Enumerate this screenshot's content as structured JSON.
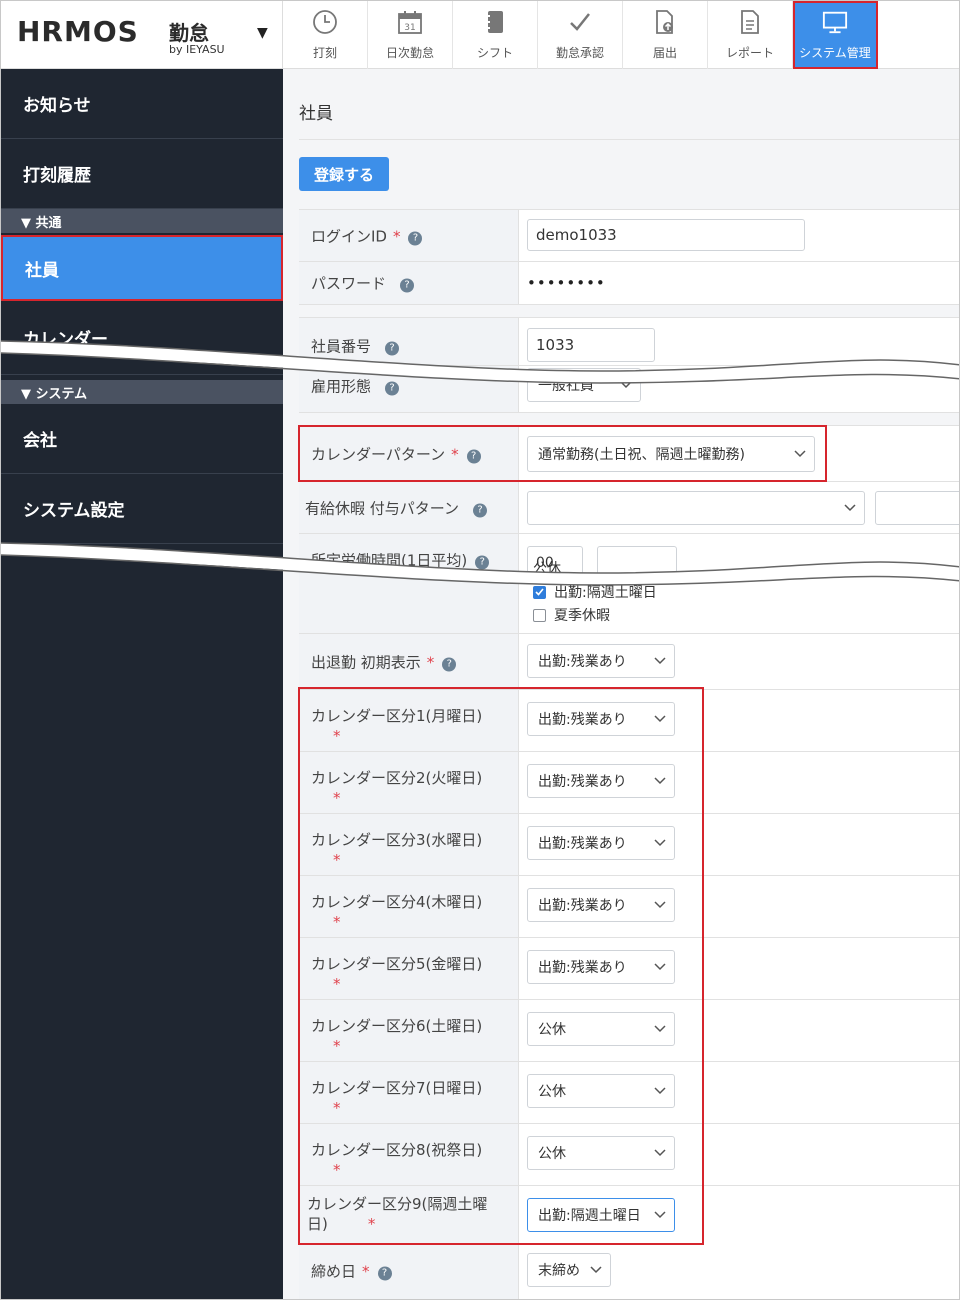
{
  "app": {
    "logo_text": "HRMOS",
    "logo_kintai": "勤怠",
    "logo_by": "by IEYASU"
  },
  "topnav": [
    {
      "label": "打刻",
      "icon": "clock-icon"
    },
    {
      "label": "日次勤怠",
      "icon": "calendar-icon"
    },
    {
      "label": "シフト",
      "icon": "notebook-icon"
    },
    {
      "label": "勤怠承認",
      "icon": "checkmark-icon"
    },
    {
      "label": "届出",
      "icon": "document-upload-icon"
    },
    {
      "label": "レポート",
      "icon": "report-icon"
    },
    {
      "label": "システム管理",
      "icon": "monitor-icon",
      "active": true
    }
  ],
  "sidebar": {
    "items_top": [
      {
        "label": "お知らせ"
      },
      {
        "label": "打刻履歴"
      }
    ],
    "section_common": "▼ 共通",
    "item_employee": "社員",
    "item_calendar_partial": "カレンダー",
    "section_system": "▼ システム",
    "item_company": "会社",
    "item_system_settings": "システム設定"
  },
  "main": {
    "page_title": "社員",
    "register_button": "登録する",
    "rows": {
      "login_id": {
        "label": "ログインID",
        "value": "demo1033",
        "required": true
      },
      "password": {
        "label": "パスワード",
        "value": "••••••••"
      },
      "employee_no": {
        "label": "社員番号",
        "value": "1033"
      },
      "employment_type": {
        "label": "雇用形態",
        "value": "一般社員"
      },
      "calendar_pattern": {
        "label": "カレンダーパターン",
        "value": "通常勤務(土日祝、隔週土曜勤務)",
        "required": true
      },
      "paid_leave": {
        "label": "有給休暇 付与パターン",
        "value": ""
      },
      "work_hours": {
        "label": "所定労働時間(1日平均)",
        "value": "00"
      },
      "checks": [
        {
          "label": "公休",
          "checked": false
        },
        {
          "label": "出勤:隔週土曜日",
          "checked": true
        },
        {
          "label": "夏季休暇",
          "checked": false
        }
      ],
      "initial_display": {
        "label": "出退勤 初期表示",
        "value": "出勤:残業あり",
        "required": true
      },
      "calendar_divisions": [
        {
          "label": "カレンダー区分1(月曜日)",
          "value": "出勤:残業あり"
        },
        {
          "label": "カレンダー区分2(火曜日)",
          "value": "出勤:残業あり"
        },
        {
          "label": "カレンダー区分3(水曜日)",
          "value": "出勤:残業あり"
        },
        {
          "label": "カレンダー区分4(木曜日)",
          "value": "出勤:残業あり"
        },
        {
          "label": "カレンダー区分5(金曜日)",
          "value": "出勤:残業あり"
        },
        {
          "label": "カレンダー区分6(土曜日)",
          "value": "公休"
        },
        {
          "label": "カレンダー区分7(日曜日)",
          "value": "公休"
        },
        {
          "label": "カレンダー区分8(祝祭日)",
          "value": "公休"
        },
        {
          "label_line1": "カレンダー区分9(隔週土曜",
          "label_line2": "日)",
          "value": "出勤:隔週土曜日"
        }
      ],
      "closing_day": {
        "label": "締め日",
        "value": "末締め",
        "required": true
      }
    }
  },
  "colors": {
    "accent": "#3d8fe9",
    "sidebar_bg": "#1f2631",
    "highlight_red": "#d6252d"
  }
}
